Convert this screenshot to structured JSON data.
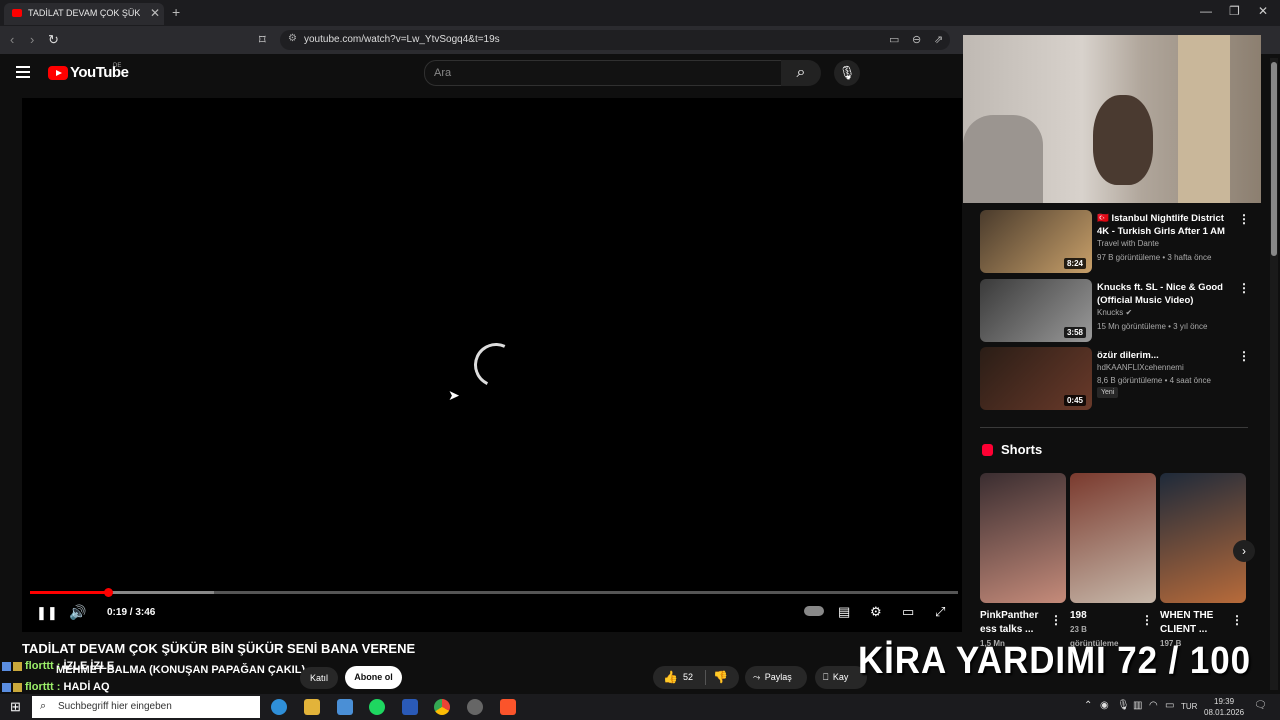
{
  "browser": {
    "tab_title": "TADİLAT DEVAM ÇOK ŞÜKÜR Bİ",
    "tab_close": "✕",
    "new_tab": "+",
    "url": "youtube.com/watch?v=Lw_YtvSogq4&t=19s",
    "window_controls": [
      "—",
      "❐",
      "✕"
    ]
  },
  "youtube_header": {
    "logo_text": "YouTube",
    "region": "DE",
    "search_placeholder": "Ara"
  },
  "player": {
    "time": "0:19 / 3:46",
    "progress_fraction": 0.084,
    "buffered_fraction": 0.198
  },
  "video": {
    "title": "TADİLAT DEVAM ÇOK ŞÜKÜR BİN ŞÜKÜR SENİ BANA VERENE",
    "channel_partial": "MEHMET BALMA (KONUŞAN PAPAĞAN ÇAKIL)",
    "join_label": "Katıl",
    "subscribe_label": "Abone ol",
    "likes": "52",
    "share_label": "Paylaş",
    "save_label": "Kay"
  },
  "chat": [
    {
      "user": "florttt",
      "message": "İZLE İZLE"
    },
    {
      "user": "florttt",
      "message": "HADİ AQ"
    }
  ],
  "recommendations": [
    {
      "title": "🇹🇷 Istanbul Nightlife District 4K - Turkish Girls After 1 AM",
      "channel": "Travel with Dante",
      "meta": "97 B görüntüleme • 3 hafta önce",
      "duration": "8:24",
      "thumb_colors": [
        "#4a3b2c",
        "#c8a06a"
      ]
    },
    {
      "title": "Knucks ft. SL - Nice & Good (Official Music Video)",
      "channel": "Knucks ✔",
      "meta": "15 Mn görüntüleme • 3 yıl önce",
      "duration": "3:58",
      "thumb_colors": [
        "#3a3a3a",
        "#9a9a9a"
      ]
    },
    {
      "title": "özür dilerim...",
      "channel": "hdKAANFLIXcehennemi",
      "meta": "8,6 B görüntüleme • 4 saat önce",
      "duration": "0:45",
      "badge": "Yeni",
      "thumb_colors": [
        "#2a1d16",
        "#6a3a2a"
      ]
    }
  ],
  "shorts": {
    "label": "Shorts",
    "items": [
      {
        "title": "PinkPanther ess talks ...",
        "meta": "1,5 Mn",
        "thumb_colors": [
          "#3a2d30",
          "#c58b7a"
        ]
      },
      {
        "title": "198",
        "meta": "23 B görüntüleme",
        "thumb_colors": [
          "#7a3a2e",
          "#c7b8aa"
        ]
      },
      {
        "title": "WHEN THE CLIENT ...",
        "meta": "197 B",
        "thumb_colors": [
          "#1e2a3a",
          "#b86b3a"
        ]
      }
    ]
  },
  "overlay": {
    "text": "KİRA YARDIMI  72 / 100"
  },
  "taskbar": {
    "search_placeholder": "Suchbegriff hier eingeben",
    "language": "TUR",
    "time": "19:39",
    "date": "08.01.2026"
  },
  "colors": {
    "accent": "#ff0000",
    "chat_user": "#9cf06a",
    "background": "#0f0f0f"
  }
}
